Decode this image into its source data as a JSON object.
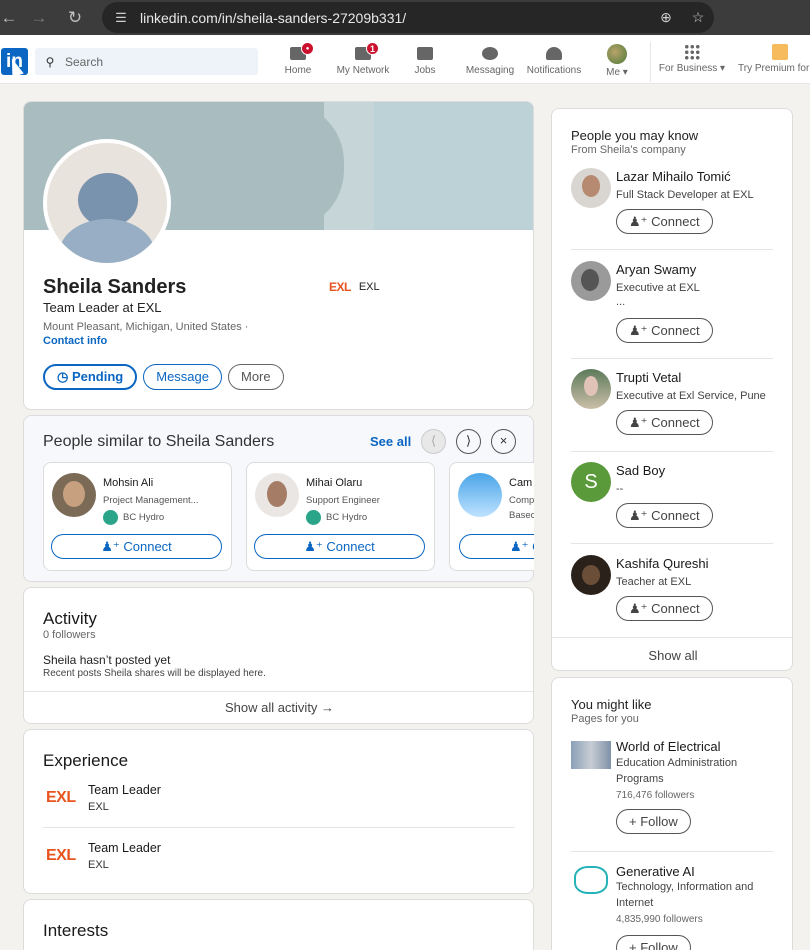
{
  "browser": {
    "url": "linkedin.com/in/sheila-sanders-27209b331/",
    "back": "←",
    "forward": "→",
    "reload": "↻"
  },
  "topnav": {
    "logo": "in",
    "search_placeholder": "Search",
    "items": [
      {
        "label": "Home",
        "badge": "●"
      },
      {
        "label": "My Network",
        "badge": "1"
      },
      {
        "label": "Jobs",
        "badge": ""
      },
      {
        "label": "Messaging",
        "badge": ""
      },
      {
        "label": "Notifications",
        "badge": ""
      },
      {
        "label": "Me ▾",
        "badge": ""
      },
      {
        "label": "For Business ▾",
        "badge": ""
      },
      {
        "label": "Try Premium for",
        "badge": ""
      }
    ]
  },
  "profile": {
    "name": "Sheila Sanders",
    "headline": "Team Leader at EXL",
    "location": "Mount Pleasant, Michigan, United States ·",
    "contact": "Contact info",
    "company_logo": "EXL",
    "company": "EXL",
    "buttons": {
      "pending": "Pending",
      "message": "Message",
      "more": "More"
    }
  },
  "similar": {
    "title": "People similar to Sheila Sanders",
    "see_all": "See all",
    "people": [
      {
        "name": "Mohsin Ali",
        "headline": "Project Management...",
        "company": "BC Hydro",
        "connect": "Connect"
      },
      {
        "name": "Mihai Olaru",
        "headline": "Support Engineer",
        "company": "BC Hydro",
        "connect": "Connect"
      },
      {
        "name": "Cam",
        "headline": "Comp",
        "company": "Basec",
        "connect": "C"
      }
    ]
  },
  "activity": {
    "title": "Activity",
    "followers": "0 followers",
    "empty_title": "Sheila hasn’t posted yet",
    "empty_sub": "Recent posts Sheila shares will be displayed here.",
    "show_all": "Show all activity →"
  },
  "experience": {
    "title": "Experience",
    "items": [
      {
        "logo": "EXL",
        "role": "Team Leader",
        "company": "EXL"
      },
      {
        "logo": "EXL",
        "role": "Team Leader",
        "company": "EXL"
      }
    ]
  },
  "interests": {
    "title": "Interests"
  },
  "pymk": {
    "title": "People you may know",
    "subtitle": "From Sheila’s company",
    "show_all": "Show all",
    "people": [
      {
        "name": "Lazar Mihailo Tomić",
        "headline": "Full Stack Developer at EXL",
        "extra": "",
        "connect": "Connect"
      },
      {
        "name": "Aryan Swamy",
        "headline": "Executive at EXL",
        "extra": "...",
        "connect": "Connect"
      },
      {
        "name": "Trupti Vetal",
        "headline": "Executive at Exl Service, Pune",
        "extra": "",
        "connect": "Connect"
      },
      {
        "name": "Sad Boy",
        "headline": "--",
        "extra": "",
        "connect": "Connect",
        "initial": "S"
      },
      {
        "name": "Kashifa Qureshi",
        "headline": "Teacher at EXL",
        "extra": "",
        "connect": "Connect"
      }
    ]
  },
  "ymk": {
    "title": "You might like",
    "subtitle": "Pages for you",
    "pages": [
      {
        "name": "World of Electrical",
        "industry_1": "Education Administration",
        "industry_2": "Programs",
        "followers": "716,476 followers",
        "follow": "Follow"
      },
      {
        "name": "Generative AI",
        "industry_1": "Technology, Information and",
        "industry_2": "Internet",
        "followers": "4,835,990 followers",
        "follow": "Follow"
      }
    ]
  },
  "colors": {
    "brand": "#0a66c2",
    "exl": "#e8541e",
    "badge": "#cb112d"
  }
}
